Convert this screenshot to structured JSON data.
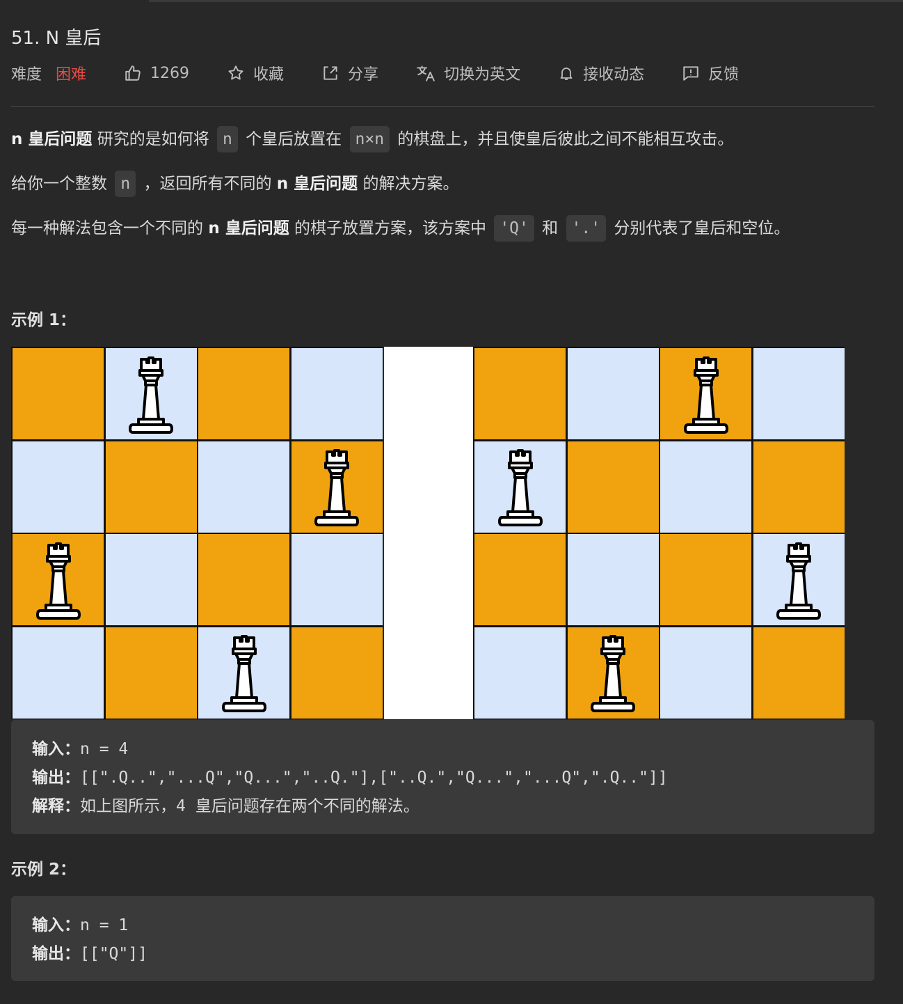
{
  "title": "51. N 皇后",
  "meta": {
    "difficulty_label": "难度",
    "difficulty_value": "困难",
    "likes": "1269",
    "favorite": "收藏",
    "share": "分享",
    "translate": "切换为英文",
    "notify": "接收动态",
    "feedback": "反馈"
  },
  "description": {
    "p1": {
      "b1": "n 皇后问题",
      "t1": " 研究的是如何将 ",
      "c1": "n",
      "t2": " 个皇后放置在 ",
      "c2": "n×n",
      "t3": " 的棋盘上，并且使皇后彼此之间不能相互攻击。"
    },
    "p2": {
      "t1": "给你一个整数 ",
      "c1": "n",
      "t2": " ，返回所有不同的 ",
      "b1": "n 皇后问题",
      "t3": " 的解决方案。"
    },
    "p3": {
      "t1": "每一种解法包含一个不同的 ",
      "b1": "n 皇后问题",
      "t2": " 的棋子放置方案，该方案中 ",
      "c1": "'Q'",
      "t3": " 和 ",
      "c2": "'.'",
      "t4": " 分别代表了皇后和空位。"
    }
  },
  "example1": {
    "heading": "示例 1：",
    "boards": [
      {
        "queens": [
          1,
          3,
          0,
          2
        ]
      },
      {
        "queens": [
          2,
          0,
          3,
          1
        ]
      }
    ],
    "input_label": "输入：",
    "input_value": "n = 4",
    "output_label": "输出：",
    "output_value": "[[\".Q..\",\"...Q\",\"Q...\",\"..Q.\"],[\"..Q.\",\"Q...\",\"...Q\",\".Q..\"]]",
    "explain_label": "解释：",
    "explain_value": "如上图所示，4 皇后问题存在两个不同的解法。"
  },
  "example2": {
    "heading": "示例 2：",
    "input_label": "输入：",
    "input_value": "n = 1",
    "output_label": "输出：",
    "output_value": "[[\"Q\"]]"
  },
  "colors": {
    "background": "#282828",
    "hard": "#ef4743",
    "board_dark": "#f0a30f",
    "board_light": "#d7e6fb",
    "code_bg": "#3c3c3c"
  }
}
